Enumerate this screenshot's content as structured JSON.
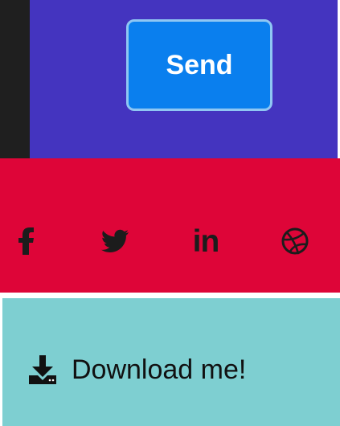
{
  "form": {
    "send_label": "Send",
    "background": "#4434bf",
    "button_color": "#0a7fee"
  },
  "social": {
    "background": "#de0538",
    "items": [
      {
        "icon": "facebook-icon"
      },
      {
        "icon": "twitter-icon"
      },
      {
        "icon": "linkedin-icon",
        "label": "in"
      },
      {
        "icon": "dribbble-icon"
      }
    ]
  },
  "download": {
    "background": "#7ecfd1",
    "icon": "download-icon",
    "label": "Download me!"
  }
}
